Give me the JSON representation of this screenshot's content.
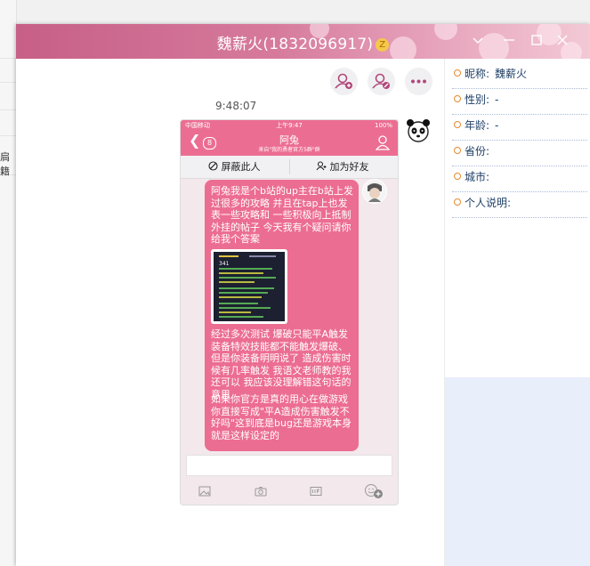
{
  "background": {
    "partial_text": "扃籍"
  },
  "window": {
    "title": "魏薪火(1832096917)",
    "title_badge": "Z",
    "colors": {
      "titlebar": "#d67a9c",
      "bubble": "#ec6d92",
      "side_lower": "#e9eefb"
    }
  },
  "toolbar": {
    "buttons": [
      {
        "icon": "add-friend-icon"
      },
      {
        "icon": "block-user-icon"
      },
      {
        "icon": "more-icon",
        "label": "•••"
      }
    ]
  },
  "chat": {
    "timestamp": "9:48:07",
    "phone": {
      "carrier": "中国移动",
      "time": "上午9:47",
      "battery": "100%",
      "back_count": "8",
      "contact_name": "阿兔",
      "contact_source": "来自\"我的勇者官方5群\"群",
      "block_label": "屏蔽此人",
      "add_label": "加为好友",
      "message_part1": "阿兔我是个b站的up主在b站上发过很多的攻略 并且在tap上也发表一些攻略和 一些积极向上抵制外挂的帖子 今天我有个疑问请你给我个答案",
      "message_part2": "经过多次测试 爆破只能平A触发 装备特效技能都不能触发爆破、但是你装备明明说了 造成伤害时候有几率触发 我语文老师教的我还可以 我应该没理解错这句话的意思",
      "message_part3": "如果你官方是真的用心在做游戏 你直接写成\"平A造成伤害触发不好吗\"这到底是bug还是游戏本身就是这样设定的",
      "screenshot_number": "341"
    }
  },
  "profile": {
    "fields": [
      {
        "label": "昵称:",
        "value": "魏薪火"
      },
      {
        "label": "性别:",
        "value": "-"
      },
      {
        "label": "年龄:",
        "value": "-"
      },
      {
        "label": "省份:",
        "value": ""
      },
      {
        "label": "城市:",
        "value": ""
      },
      {
        "label": "个人说明:",
        "value": ""
      }
    ]
  }
}
